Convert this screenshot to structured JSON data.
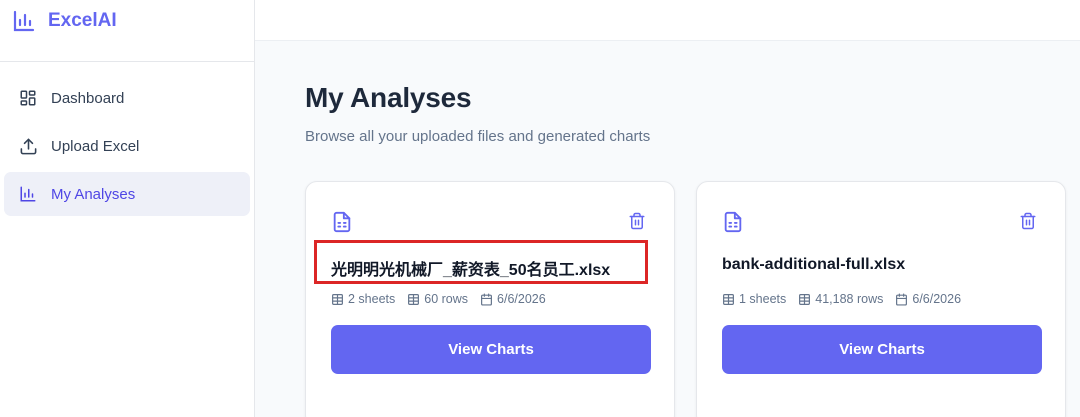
{
  "app": {
    "name": "ExcelAI"
  },
  "sidebar": {
    "items": [
      {
        "label": "Dashboard",
        "icon": "dashboard-icon",
        "active": false
      },
      {
        "label": "Upload Excel",
        "icon": "upload-icon",
        "active": false
      },
      {
        "label": "My Analyses",
        "icon": "bar-chart-icon",
        "active": true
      }
    ]
  },
  "page": {
    "title": "My Analyses",
    "subtitle": "Browse all your uploaded files and generated charts"
  },
  "files": [
    {
      "name": "光明明光机械厂_薪资表_50名员工.xlsx",
      "sheets": "2 sheets",
      "rows": "60 rows",
      "date": "6/6/2026",
      "button": "View Charts",
      "highlighted": true
    },
    {
      "name": "bank-additional-full.xlsx",
      "sheets": "1 sheets",
      "rows": "41,188 rows",
      "date": "6/6/2026",
      "button": "View Charts",
      "highlighted": false
    }
  ],
  "colors": {
    "accent": "#6366f1",
    "highlight": "#dc2626"
  }
}
